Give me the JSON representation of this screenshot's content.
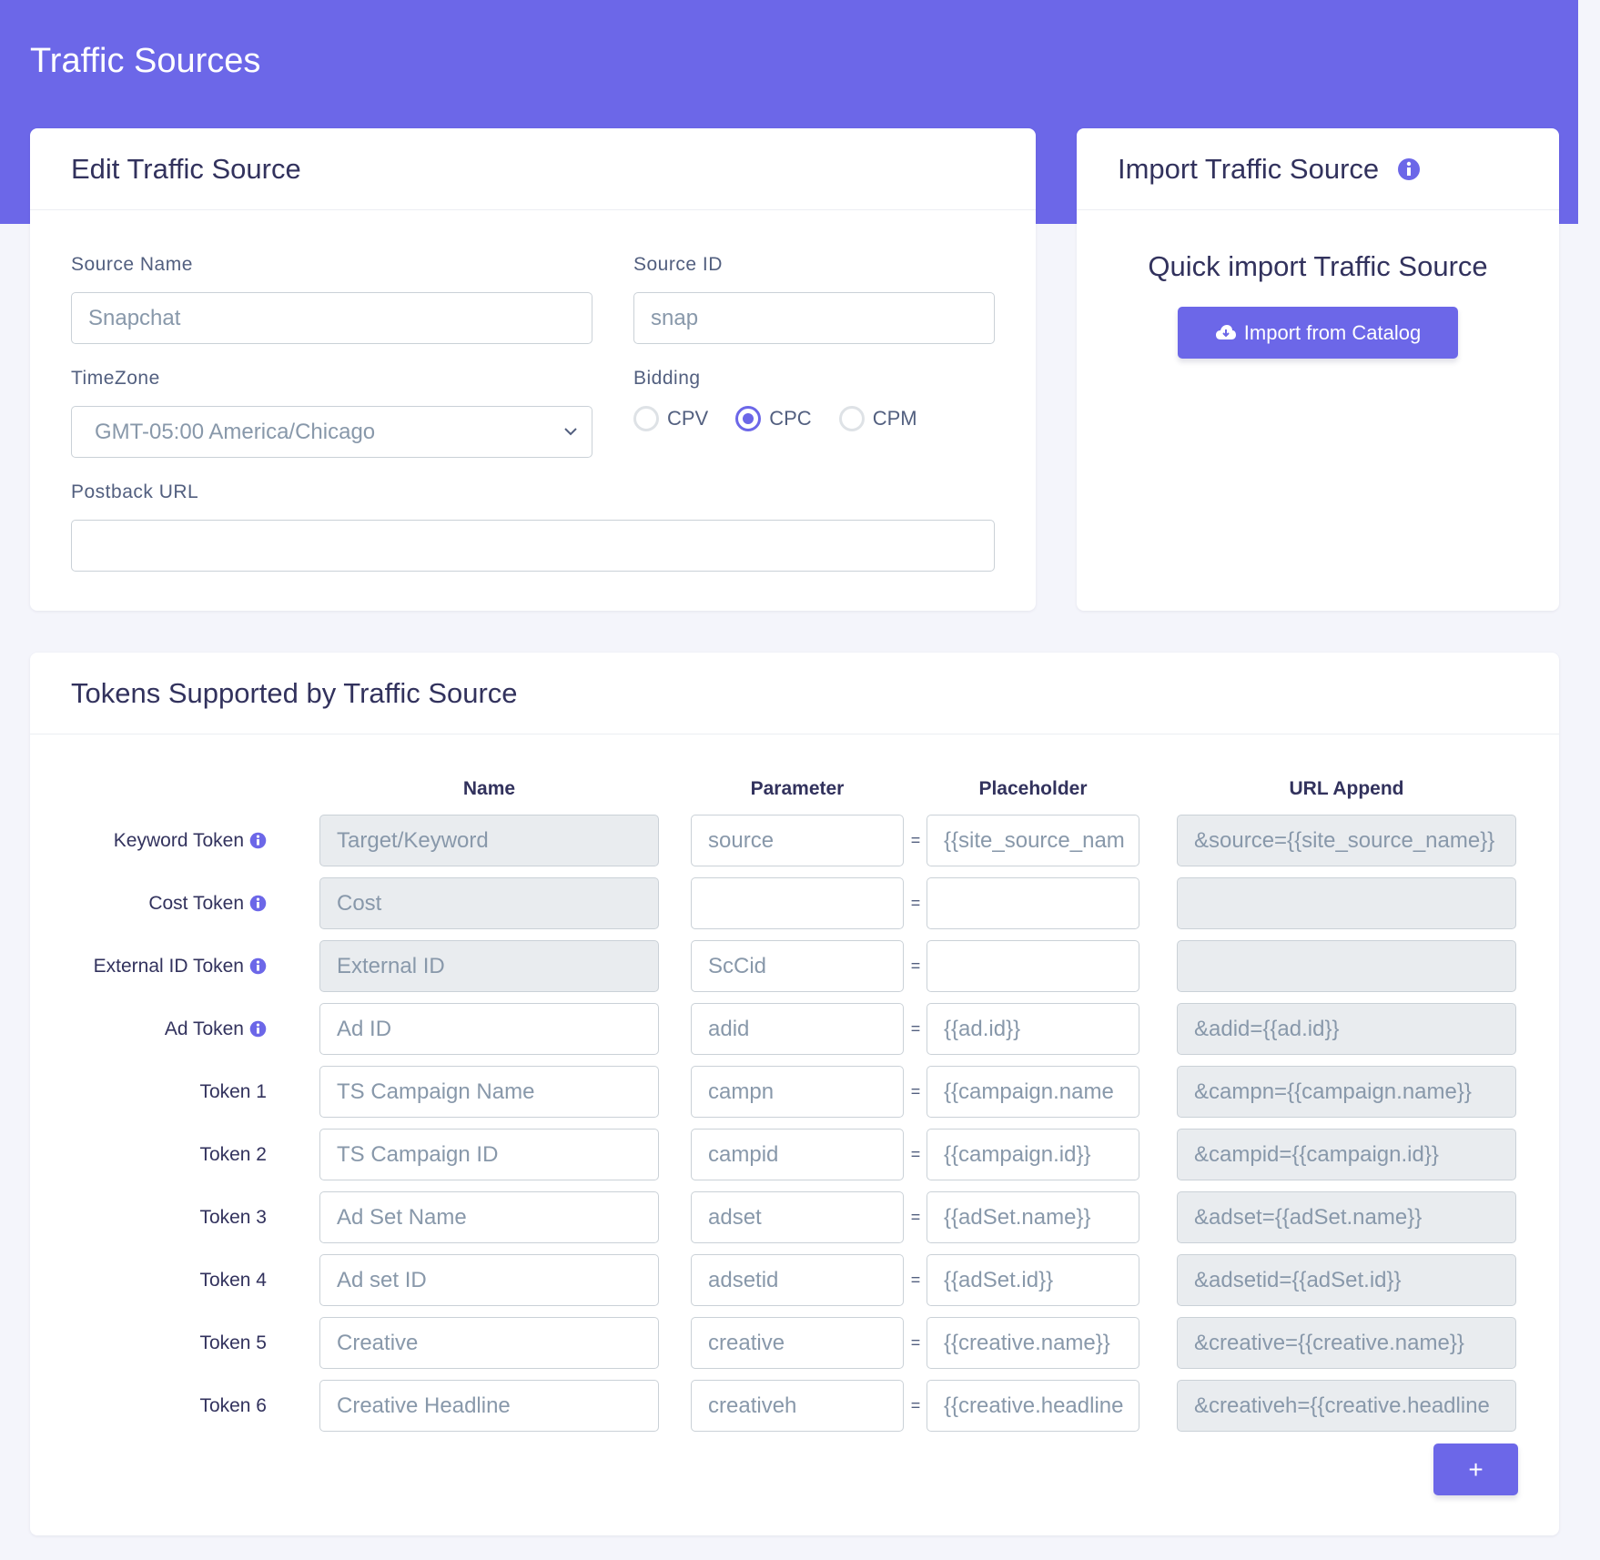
{
  "page": {
    "title": "Traffic Sources"
  },
  "colors": {
    "accent": "#6c67e8",
    "background": "#f4f5fb"
  },
  "edit": {
    "title": "Edit Traffic Source",
    "source_name_label": "Source Name",
    "source_name_value": "Snapchat",
    "source_id_label": "Source ID",
    "source_id_value": "snap",
    "timezone_label": "TimeZone",
    "timezone_value": "GMT-05:00 America/Chicago",
    "bidding_label": "Bidding",
    "bidding_options": [
      "CPV",
      "CPC",
      "CPM"
    ],
    "bidding_selected": "CPC",
    "postback_label": "Postback URL",
    "postback_value": ""
  },
  "import": {
    "title": "Import Traffic Source",
    "subtitle": "Quick import Traffic Source",
    "button_label": "Import from Catalog",
    "button_icon": "cloud-download-icon",
    "title_icon": "info-icon"
  },
  "tokens": {
    "title": "Tokens Supported by Traffic Source",
    "headers": {
      "name": "Name",
      "parameter": "Parameter",
      "placeholder": "Placeholder",
      "append": "URL Append"
    },
    "add_label": "+",
    "rows": [
      {
        "label": "Keyword Token",
        "info": true,
        "name": "Target/Keyword",
        "name_ro": true,
        "param": "source",
        "placeholder": "{{site_source_nam",
        "append": "&source={{site_source_name}}"
      },
      {
        "label": "Cost Token",
        "info": true,
        "name": "Cost",
        "name_ro": true,
        "param": "",
        "placeholder": "",
        "append": ""
      },
      {
        "label": "External ID Token",
        "info": true,
        "name": "External ID",
        "name_ro": true,
        "param": "ScCid",
        "placeholder": "",
        "append": ""
      },
      {
        "label": "Ad Token",
        "info": true,
        "name": "Ad ID",
        "name_ro": false,
        "param": "adid",
        "placeholder": "{{ad.id}}",
        "append": "&adid={{ad.id}}"
      },
      {
        "label": "Token 1",
        "info": false,
        "name": "TS Campaign Name",
        "name_ro": false,
        "param": "campn",
        "placeholder": "{{campaign.name",
        "append": "&campn={{campaign.name}}"
      },
      {
        "label": "Token 2",
        "info": false,
        "name": "TS Campaign ID",
        "name_ro": false,
        "param": "campid",
        "placeholder": "{{campaign.id}}",
        "append": "&campid={{campaign.id}}"
      },
      {
        "label": "Token 3",
        "info": false,
        "name": "Ad Set Name",
        "name_ro": false,
        "param": "adset",
        "placeholder": "{{adSet.name}}",
        "append": "&adset={{adSet.name}}"
      },
      {
        "label": "Token 4",
        "info": false,
        "name": "Ad set ID",
        "name_ro": false,
        "param": "adsetid",
        "placeholder": "{{adSet.id}}",
        "append": "&adsetid={{adSet.id}}"
      },
      {
        "label": "Token 5",
        "info": false,
        "name": "Creative",
        "name_ro": false,
        "param": "creative",
        "placeholder": "{{creative.name}}",
        "append": "&creative={{creative.name}}"
      },
      {
        "label": "Token 6",
        "info": false,
        "name": "Creative Headline",
        "name_ro": false,
        "param": "creativeh",
        "placeholder": "{{creative.headline",
        "append": "&creativeh={{creative.headline"
      }
    ]
  }
}
